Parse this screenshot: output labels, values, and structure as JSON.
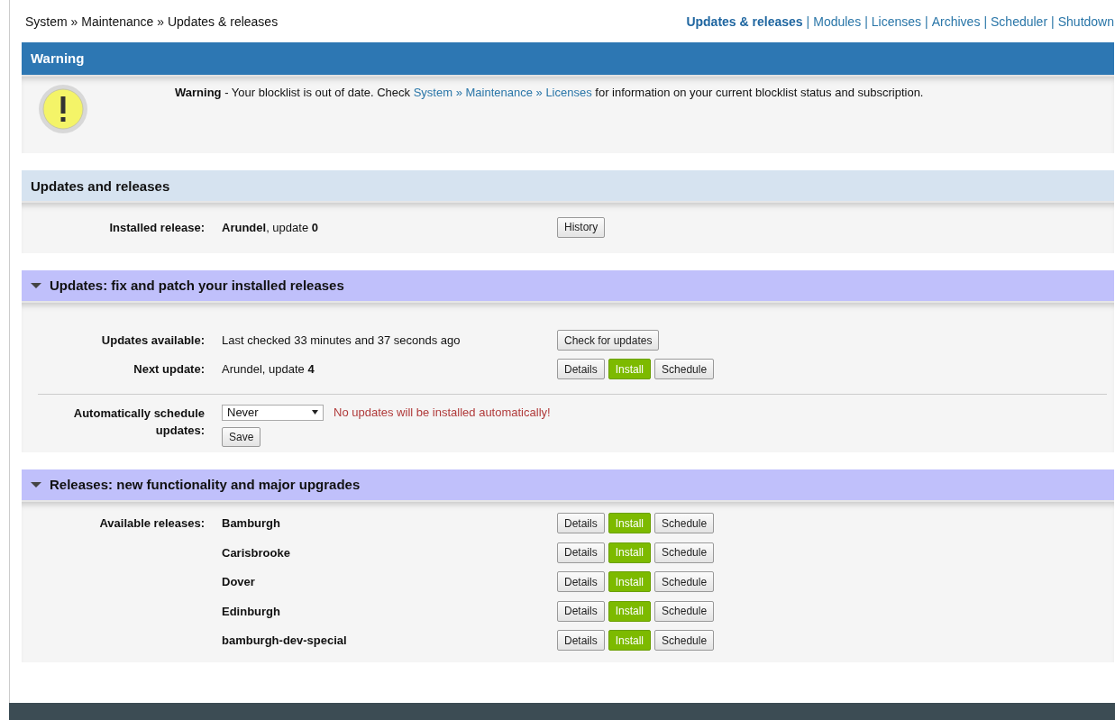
{
  "breadcrumb": "System » Maintenance » Updates & releases",
  "nav_separator": "|",
  "nav": [
    {
      "label": "Updates & releases",
      "selected": true
    },
    {
      "label": "Modules",
      "selected": false
    },
    {
      "label": "Licenses",
      "selected": false
    },
    {
      "label": "Archives",
      "selected": false
    },
    {
      "label": "Scheduler",
      "selected": false
    },
    {
      "label": "Shutdown",
      "selected": false
    }
  ],
  "warning": {
    "title": "Warning",
    "text_before": "**Warning** - Your blocklist is out of date. Check ",
    "link": "System » Maintenance » Licenses",
    "text_after": " for information on your current blocklist status and subscription."
  },
  "sections": [
    {
      "kind": "info",
      "title": "Updates and releases",
      "rows": [
        {
          "label": "Installed release:",
          "value": "**Arundel**, update **0**",
          "buttons": [
            {
              "label": "History",
              "kind": "default"
            }
          ]
        }
      ]
    },
    {
      "kind": "collapsible",
      "expanded": true,
      "title": "Updates: fix and patch your installed releases",
      "rows": [
        {
          "label": "Updates available:",
          "value": "Last checked 33 minutes and 37 seconds ago",
          "buttons": [
            {
              "label": "Check for updates",
              "kind": "default"
            }
          ]
        },
        {
          "label": "Next update:",
          "value": "Arundel, update **4**",
          "buttons": [
            {
              "label": "Details",
              "kind": "default"
            },
            {
              "label": "Install",
              "kind": "primary"
            },
            {
              "label": "Schedule",
              "kind": "default"
            }
          ]
        }
      ],
      "schedule_form": {
        "label": "Automatically schedule updates:",
        "select_value": "Never",
        "notice": "No updates will be installed automatically!",
        "save": "Save"
      }
    },
    {
      "kind": "releases",
      "expanded": true,
      "title": "Releases: new functionality and major upgrades",
      "label": "Available releases:",
      "rows": [
        {
          "value": "Bamburgh",
          "buttons": [
            {
              "label": "Details",
              "kind": "default"
            },
            {
              "label": "Install",
              "kind": "primary"
            },
            {
              "label": "Schedule",
              "kind": "default"
            }
          ]
        },
        {
          "value": "Carisbrooke",
          "buttons": [
            {
              "label": "Details",
              "kind": "default"
            },
            {
              "label": "Install",
              "kind": "primary"
            },
            {
              "label": "Schedule",
              "kind": "default"
            }
          ]
        },
        {
          "value": "Dover",
          "buttons": [
            {
              "label": "Details",
              "kind": "default"
            },
            {
              "label": "Install",
              "kind": "primary"
            },
            {
              "label": "Schedule",
              "kind": "default"
            }
          ]
        },
        {
          "value": "Edinburgh",
          "buttons": [
            {
              "label": "Details",
              "kind": "default"
            },
            {
              "label": "Install",
              "kind": "primary"
            },
            {
              "label": "Schedule",
              "kind": "default"
            }
          ]
        },
        {
          "value": "bamburgh-dev-special",
          "buttons": [
            {
              "label": "Details",
              "kind": "default"
            },
            {
              "label": "Install",
              "kind": "primary"
            },
            {
              "label": "Schedule",
              "kind": "default"
            }
          ]
        }
      ]
    }
  ]
}
